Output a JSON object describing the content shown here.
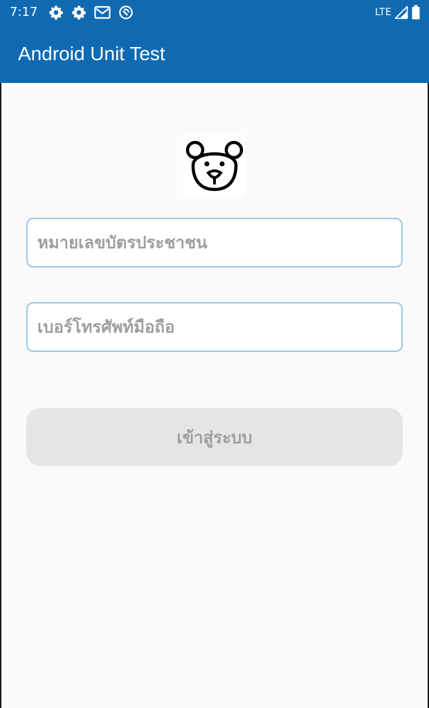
{
  "status_bar": {
    "time": "7:17",
    "left_icons": [
      "gear-icon",
      "gear-icon",
      "gmail-icon",
      "no-disturb-icon"
    ],
    "network": "LTE",
    "right_icons": [
      "signal-icon",
      "battery-icon"
    ],
    "background": "#106ab2"
  },
  "app_bar": {
    "title": "Android Unit Test",
    "background": "#106ab2"
  },
  "logo": {
    "icon": "bear-icon"
  },
  "form": {
    "id_card": {
      "placeholder": "หมายเลขบัตรประชาชน",
      "value": ""
    },
    "phone": {
      "placeholder": "เบอร์โทรศัพท์มือถือ",
      "value": ""
    },
    "login_button": {
      "label": "เข้าสู่ระบบ",
      "state": "disabled"
    }
  },
  "colors": {
    "field_border": "#9fc5e3",
    "button_bg": "#e5e5e5",
    "button_text": "#9e9e9e",
    "page_bg": "#fafafa"
  }
}
